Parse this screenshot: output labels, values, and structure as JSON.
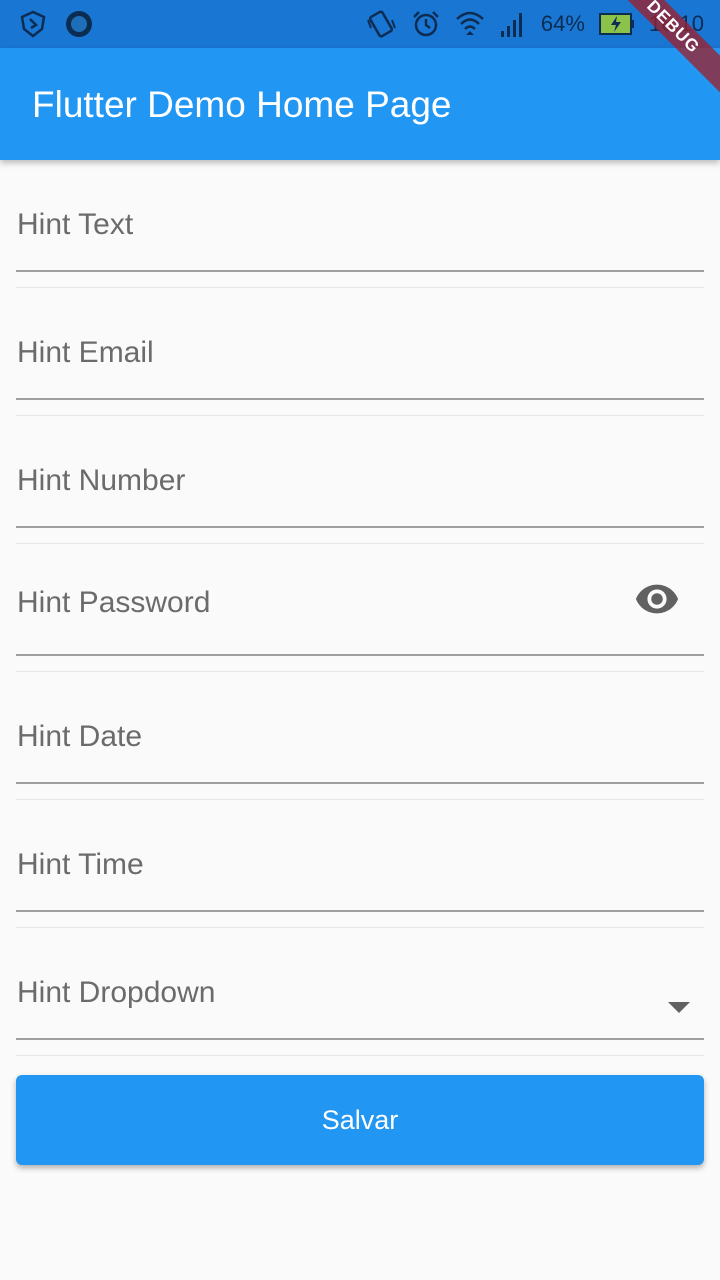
{
  "status_bar": {
    "battery_percent": "64%",
    "time": "16:10",
    "icons": [
      "shield-icon",
      "circle-notification-icon",
      "vibrate-icon",
      "alarm-icon",
      "wifi-icon",
      "signal-icon",
      "battery-charging-icon"
    ]
  },
  "app_bar": {
    "title": "Flutter Demo Home Page"
  },
  "debug_banner": "DEBUG",
  "form": {
    "fields": [
      {
        "hint": "Hint Text"
      },
      {
        "hint": "Hint Email"
      },
      {
        "hint": "Hint Number"
      },
      {
        "hint": "Hint Password",
        "icon": "eye-icon"
      },
      {
        "hint": "Hint Date"
      },
      {
        "hint": "Hint Time"
      },
      {
        "hint": "Hint Dropdown",
        "icon": "dropdown-arrow-icon"
      }
    ]
  },
  "save_button": {
    "label": "Salvar"
  },
  "colors": {
    "status_bar": "#1976d2",
    "app_bar": "#2196f3",
    "button": "#2196f3",
    "background": "#fafafa"
  }
}
